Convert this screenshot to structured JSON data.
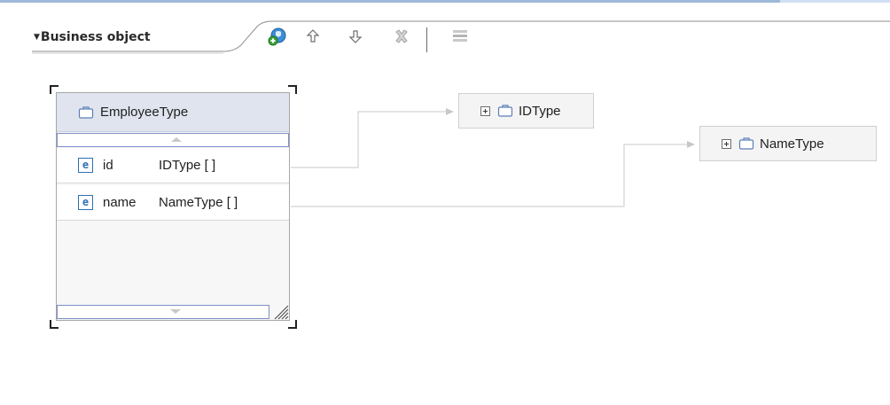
{
  "section": {
    "title": "Business object",
    "toolbar": {
      "add_icon": "add-business-object-icon",
      "move_up_icon": "arrow-up-icon",
      "move_down_icon": "arrow-down-icon",
      "delete_icon": "delete-icon",
      "layout_icon": "layout-icon"
    }
  },
  "business_object": {
    "name": "EmployeeType",
    "fields": [
      {
        "badge": "e",
        "name": "id",
        "type": "IDType [ ]"
      },
      {
        "badge": "e",
        "name": "name",
        "type": "NameType [ ]"
      }
    ]
  },
  "referenced_types": [
    {
      "name": "IDType"
    },
    {
      "name": "NameType"
    }
  ],
  "colors": {
    "header_bg": "#dfe4ee",
    "element_badge": "#2f6fb5",
    "connector": "#c8c8c8"
  }
}
